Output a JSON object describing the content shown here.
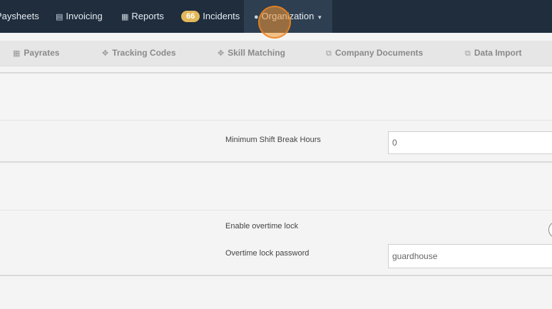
{
  "nav": {
    "items": [
      {
        "label": "Paysheets",
        "icon": "file-icon"
      },
      {
        "label": "Invoicing",
        "icon": "invoice-icon"
      },
      {
        "label": "Reports",
        "icon": "table-icon"
      },
      {
        "label": "Incidents",
        "badge": "66"
      },
      {
        "label": "Organization",
        "icon": "users-icon"
      }
    ]
  },
  "subnav": {
    "tabs": [
      {
        "label": "Payrates",
        "icon": "calendar-icon"
      },
      {
        "label": "Tracking Codes",
        "icon": "crosshair-icon"
      },
      {
        "label": "Skill Matching",
        "icon": "crosshair-icon"
      },
      {
        "label": "Company Documents",
        "icon": "copy-icon"
      },
      {
        "label": "Data Import",
        "icon": "copy-icon"
      }
    ]
  },
  "settings": {
    "min_shift_break": {
      "label": "Minimum Shift Break Hours",
      "value": "0"
    },
    "overtime_lock": {
      "label": "Enable overtime lock"
    },
    "overtime_password": {
      "label": "Overtime lock password",
      "value": "guardhouse"
    }
  }
}
